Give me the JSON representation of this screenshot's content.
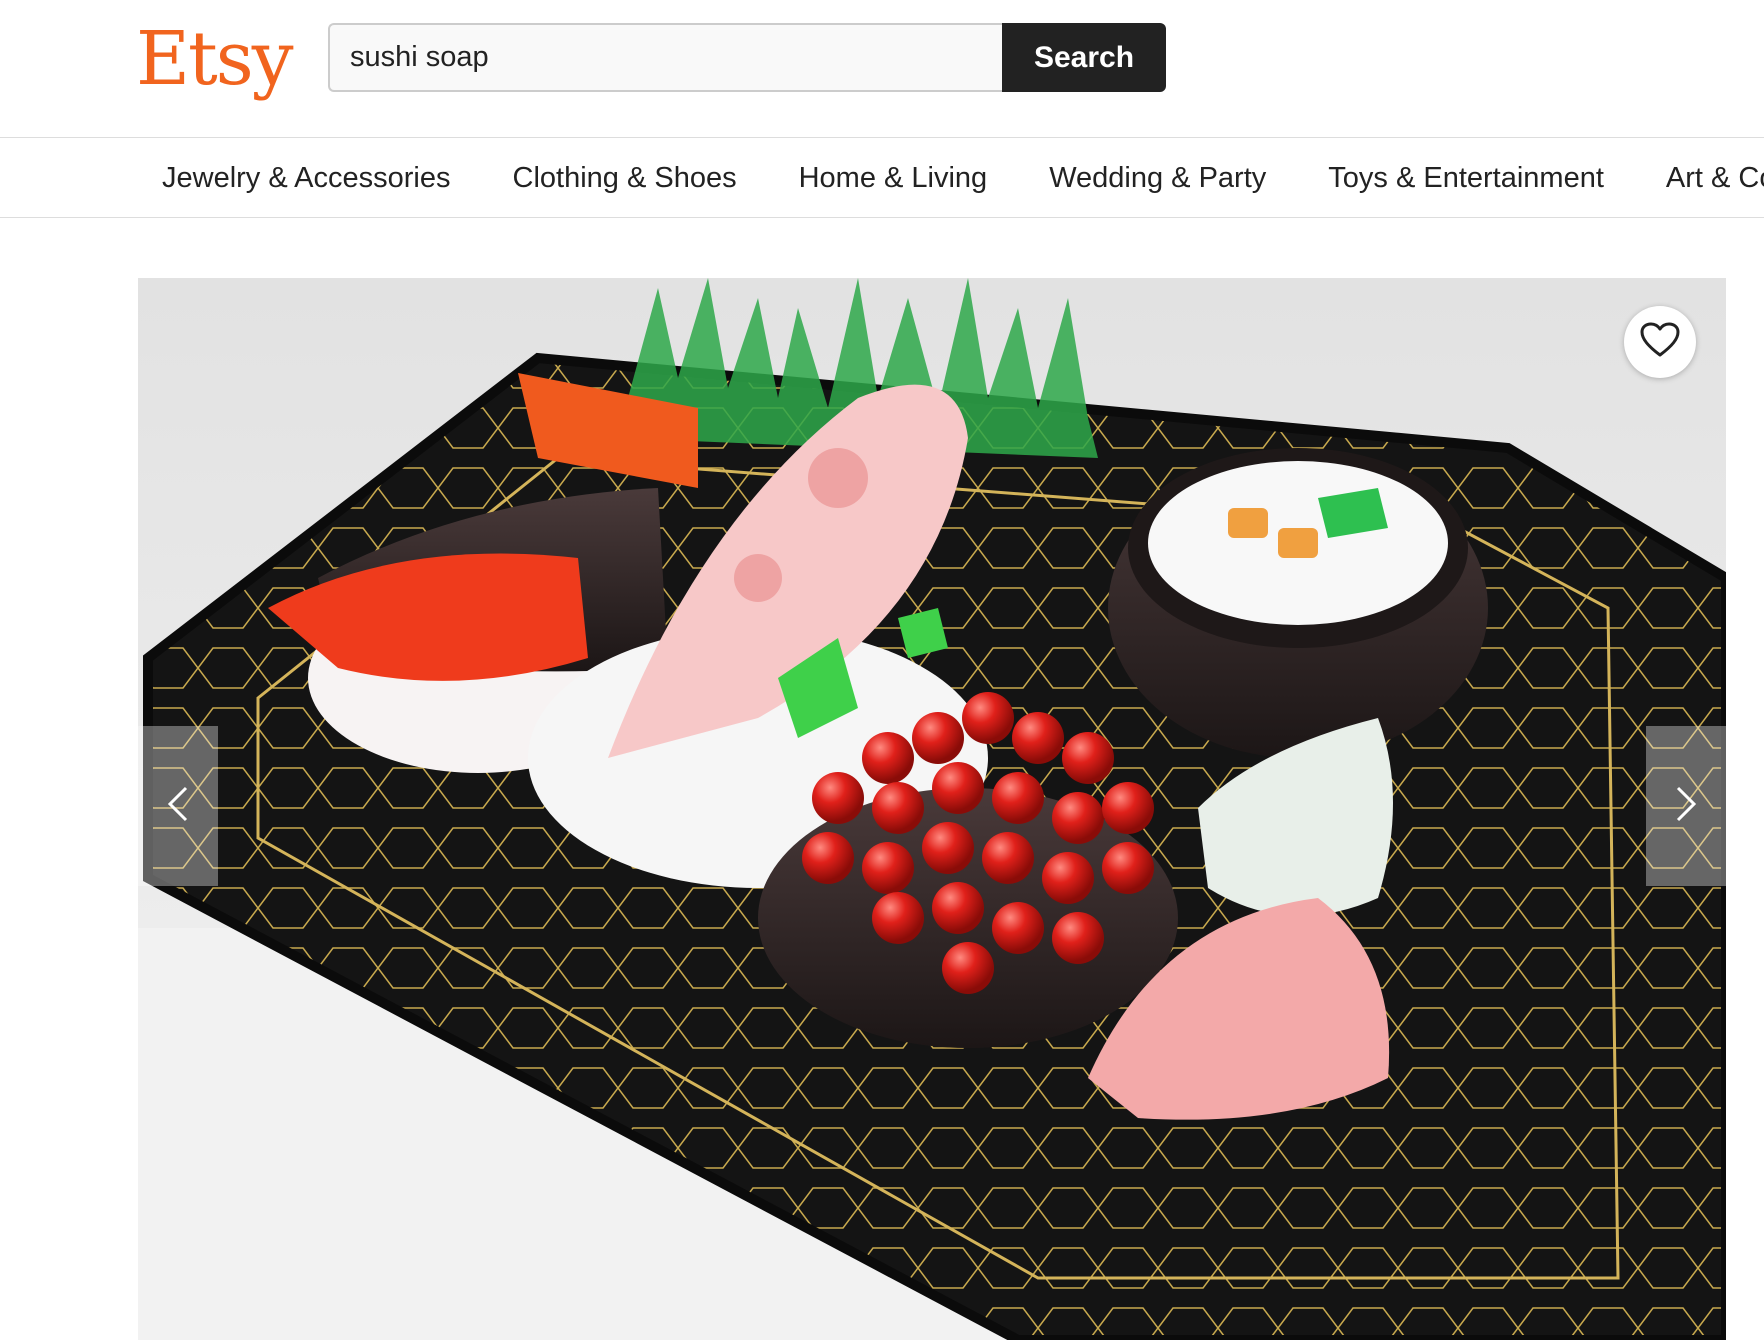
{
  "header": {
    "logo_text": "Etsy",
    "brand_color": "#F1641E"
  },
  "search": {
    "value": "sushi soap",
    "button_label": "Search"
  },
  "nav": {
    "categories": [
      "Jewelry & Accessories",
      "Clothing & Shoes",
      "Home & Living",
      "Wedding & Party",
      "Toys & Entertainment",
      "Art & Collectibles"
    ]
  },
  "listing": {
    "image_subject": "sushi-shaped soap set in black bento tray",
    "favorite_icon": "heart-outline-icon",
    "prev_icon": "chevron-left-icon",
    "next_icon": "chevron-right-icon"
  }
}
